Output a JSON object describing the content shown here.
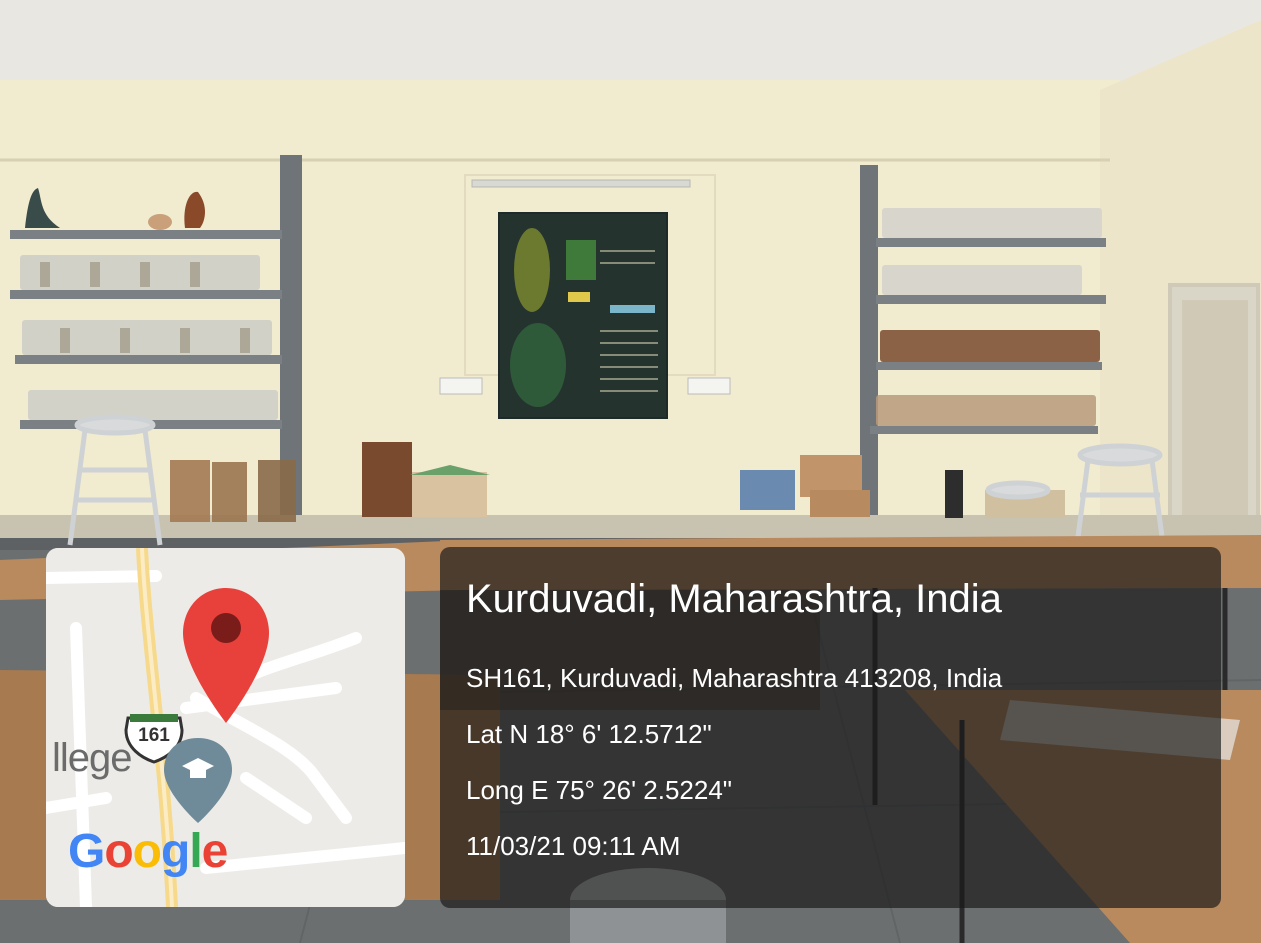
{
  "location": {
    "title": "Kurduvadi, Maharashtra, India",
    "address": "SH161, Kurduvadi, Maharashtra 413208, India",
    "latitude": "Lat N 18° 6' 12.5712\"",
    "longitude": "Long E 75° 26' 2.5224\"",
    "timestamp": "11/03/21 09:11 AM"
  },
  "map": {
    "road_shield": "161",
    "place_label": "llege",
    "logo_letters": [
      "G",
      "o",
      "o",
      "g",
      "l",
      "e"
    ],
    "pin_color": "#E8413B",
    "icons": [
      "map-pin-icon",
      "college-pin-icon",
      "highway-shield-icon"
    ]
  },
  "colors": {
    "wall": "#F1EBCF",
    "ceiling": "#E9E7E2",
    "shelf": "#6E7478",
    "chart_board": "#1E2A2A",
    "table_top": "#B98A5E",
    "floor": "#6C6F70",
    "overlay": "#191919"
  }
}
